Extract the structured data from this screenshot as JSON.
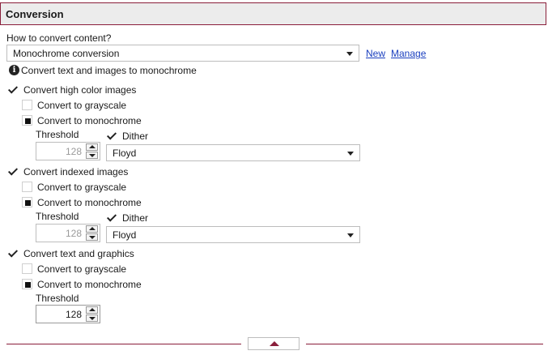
{
  "section": {
    "title": "Conversion"
  },
  "conversion": {
    "question": "How to convert content?",
    "selected": "Monochrome conversion",
    "new_link": "New",
    "manage_link": "Manage",
    "info_text": "Convert text and images to monochrome"
  },
  "high_color": {
    "label": "Convert high color images",
    "grayscale": "Convert to grayscale",
    "monochrome": "Convert to monochrome",
    "threshold_label": "Threshold",
    "threshold_value": "128",
    "dither_label": "Dither",
    "dither_method": "Floyd"
  },
  "indexed": {
    "label": "Convert indexed images",
    "grayscale": "Convert to grayscale",
    "monochrome": "Convert to monochrome",
    "threshold_label": "Threshold",
    "threshold_value": "128",
    "dither_label": "Dither",
    "dither_method": "Floyd"
  },
  "text_graphics": {
    "label": "Convert text and graphics",
    "grayscale": "Convert to grayscale",
    "monochrome": "Convert to monochrome",
    "threshold_label": "Threshold",
    "threshold_value": "128"
  },
  "colors": {
    "accent": "#8a1e3a",
    "link": "#1a3fbf"
  }
}
